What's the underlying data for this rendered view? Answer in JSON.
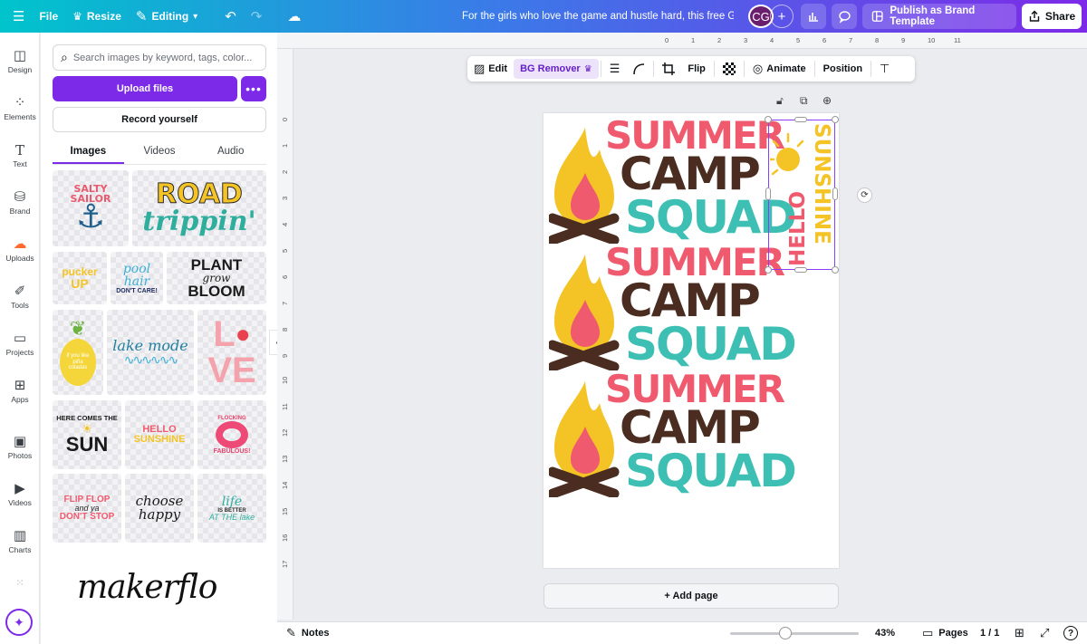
{
  "topbar": {
    "menu_icon": "menu-icon",
    "file_label": "File",
    "resize_label": "Resize",
    "editing_label": "Editing",
    "doc_title": "For the girls who love the game and hustle hard, this free Gi...",
    "avatar_initials": "CG",
    "publish_label": "Publish as Brand Template",
    "share_label": "Share"
  },
  "rail": {
    "items": [
      {
        "label": "Design",
        "icon": "design-icon"
      },
      {
        "label": "Elements",
        "icon": "elements-icon"
      },
      {
        "label": "Text",
        "icon": "text-icon"
      },
      {
        "label": "Brand",
        "icon": "brand-icon"
      },
      {
        "label": "Uploads",
        "icon": "uploads-icon"
      },
      {
        "label": "Tools",
        "icon": "tools-icon"
      },
      {
        "label": "Projects",
        "icon": "projects-icon"
      },
      {
        "label": "Apps",
        "icon": "apps-icon"
      },
      {
        "label": "Photos",
        "icon": "photos-icon"
      },
      {
        "label": "Videos",
        "icon": "videos-icon"
      },
      {
        "label": "Charts",
        "icon": "charts-icon"
      }
    ]
  },
  "panel": {
    "search_placeholder": "Search images by keyword, tags, color...",
    "upload_label": "Upload files",
    "more_label": "•••",
    "record_label": "Record yourself",
    "tabs": [
      "Images",
      "Videos",
      "Audio"
    ],
    "active_tab": "Images",
    "thumbs": {
      "salty": "SALTY SAILOR",
      "road": "ROAD",
      "trippin": "trippin'",
      "pucker": "pucker",
      "pucker_up": "UP",
      "pool": "pool",
      "hair": "hair",
      "dont_care": "DON'T CARE!",
      "plant": "PLANT",
      "grow": "grow",
      "bloom": "BLOOM",
      "pineapple_text": "if you like piña coladas",
      "lake_mode": "lake mode",
      "love_l": "L",
      "love_ve": "VE",
      "here_comes_the": "HERE COMES THE",
      "sun": "SUN",
      "hello": "HELLO",
      "sunshine": "SUNSHINE",
      "flocking": "FLOCKING",
      "fabulous": "FABULOUS!",
      "flip_flop": "FLIP FLOP",
      "and_ya": "and ya",
      "dont_stop": "DON'T STOP",
      "choose": "choose",
      "happy": "happy",
      "life_lake_1": "life",
      "life_lake_2": "IS BETTER",
      "life_lake_3": "AT THE lake"
    },
    "watermark": "makerflo"
  },
  "ruler": {
    "top": [
      "0",
      "1",
      "2",
      "3",
      "4",
      "5",
      "6",
      "7",
      "8",
      "9",
      "10",
      "11"
    ],
    "left": [
      "0",
      "1",
      "2",
      "3",
      "4",
      "5",
      "6",
      "7",
      "8",
      "9",
      "10",
      "11",
      "12",
      "13",
      "14",
      "15",
      "16",
      "17"
    ]
  },
  "context_toolbar": {
    "edit_label": "Edit",
    "bg_remover_label": "BG Remover",
    "flip_label": "Flip",
    "animate_label": "Animate",
    "position_label": "Position"
  },
  "canvas": {
    "blocks": [
      {
        "summer": "SUMMER",
        "camp": "CAMP",
        "squad": "SQUAD"
      },
      {
        "summer": "SUMMER",
        "camp": "CAMP",
        "squad": "SQUAD"
      },
      {
        "summer": "SUMMER",
        "camp": "CAMP",
        "squad": "SQUAD"
      }
    ],
    "hello": "HELLO",
    "sunshine": "SUNSHINE",
    "add_page_label": "+ Add page",
    "colors": {
      "summer": "#f05a6e",
      "camp": "#4a2c20",
      "squad": "#3dbfb3",
      "flame": "#f4c325",
      "flame_inner": "#f05a6e",
      "logs": "#4a2c20"
    }
  },
  "bottombar": {
    "notes_label": "Notes",
    "zoom_level": "43%",
    "zoom_fraction": 0.43,
    "pages_label": "Pages",
    "page_count": "1 / 1"
  }
}
